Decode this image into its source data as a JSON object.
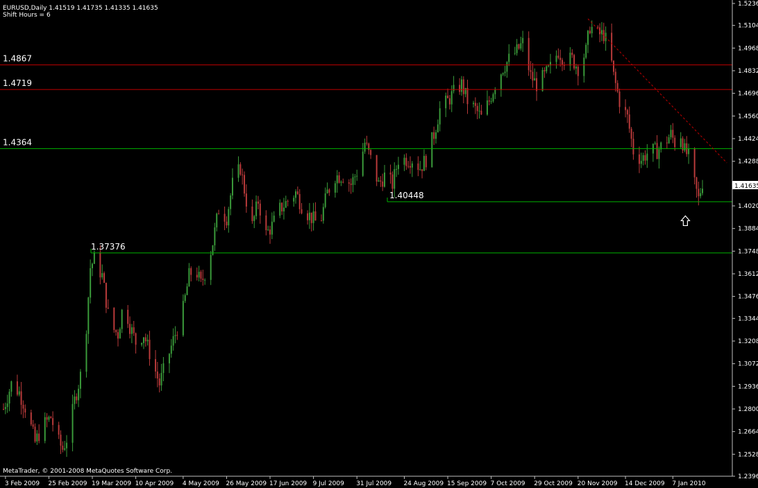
{
  "header": {
    "symbol_line": "EURUSD,Daily  1.41519 1.41735 1.41335 1.41635",
    "indicator_line": "Shift Hours = 6"
  },
  "footer": {
    "copyright": "MetaTrader, © 2001-2008 MetaQuotes Software Corp."
  },
  "current_price_label": "1.41635",
  "colors": {
    "background": "#000000",
    "bull": "#3a9a3a",
    "bear": "#b83a3a",
    "red_line": "#c00000",
    "green_line": "#00b400",
    "axis": "#c0c0c0",
    "arrow": "#ffffff"
  },
  "chart_data": {
    "type": "candlestick",
    "symbol": "EURUSD",
    "timeframe": "Daily",
    "ylim": [
      1.2396,
      1.5236
    ],
    "y_ticks": [
      "1.52360",
      "1.51040",
      "1.49680",
      "1.48320",
      "1.46960",
      "1.45600",
      "1.44240",
      "1.42880",
      "1.40200",
      "1.38840",
      "1.37480",
      "1.36120",
      "1.34760",
      "1.33440",
      "1.32080",
      "1.30720",
      "1.29360",
      "1.28000",
      "1.26640",
      "1.25280",
      "1.23960"
    ],
    "x_ticks": [
      "3 Feb 2009",
      "25 Feb 2009",
      "19 Mar 2009",
      "10 Apr 2009",
      "4 May 2009",
      "26 May 2009",
      "17 Jun 2009",
      "9 Jul 2009",
      "31 Jul 2009",
      "24 Aug 2009",
      "15 Sep 2009",
      "7 Oct 2009",
      "29 Oct 2009",
      "20 Nov 2009",
      "14 Dec 2009",
      "7 Jan 2010"
    ],
    "horizontal_levels": [
      {
        "label": "1.4867",
        "value": 1.4867,
        "color": "red"
      },
      {
        "label": "1.4719",
        "value": 1.4719,
        "color": "red"
      },
      {
        "label": "1.4364",
        "value": 1.4364,
        "color": "green"
      },
      {
        "label": "1.40448",
        "value": 1.40448,
        "color": "green"
      },
      {
        "label": "1.37376",
        "value": 1.37376,
        "color": "green"
      }
    ],
    "trendline": {
      "from": {
        "date": "2009-11-25",
        "value": 1.5144
      },
      "to": {
        "date": "2010-01-21",
        "value": 1.427
      },
      "style": "dashed",
      "color": "red"
    },
    "arrow": {
      "date": "2010-01-13",
      "value": 1.401,
      "direction": "up"
    },
    "close_path": [
      [
        "2009-02-02",
        1.28
      ],
      [
        "2009-02-06",
        1.295
      ],
      [
        "2009-02-10",
        1.29
      ],
      [
        "2009-02-14",
        1.278
      ],
      [
        "2009-02-18",
        1.26
      ],
      [
        "2009-02-22",
        1.27
      ],
      [
        "2009-02-26",
        1.275
      ],
      [
        "2009-03-02",
        1.26
      ],
      [
        "2009-03-04",
        1.256
      ],
      [
        "2009-03-07",
        1.265
      ],
      [
        "2009-03-10",
        1.285
      ],
      [
        "2009-03-13",
        1.3
      ],
      [
        "2009-03-16",
        1.33
      ],
      [
        "2009-03-18",
        1.365
      ],
      [
        "2009-03-20",
        1.37
      ],
      [
        "2009-03-24",
        1.36
      ],
      [
        "2009-03-28",
        1.33
      ],
      [
        "2009-04-01",
        1.325
      ],
      [
        "2009-04-04",
        1.345
      ],
      [
        "2009-04-07",
        1.33
      ],
      [
        "2009-04-10",
        1.32
      ],
      [
        "2009-04-14",
        1.325
      ],
      [
        "2009-04-18",
        1.31
      ],
      [
        "2009-04-22",
        1.295
      ],
      [
        "2009-04-26",
        1.31
      ],
      [
        "2009-04-30",
        1.325
      ],
      [
        "2009-05-04",
        1.34
      ],
      [
        "2009-05-07",
        1.36
      ],
      [
        "2009-05-10",
        1.365
      ],
      [
        "2009-05-13",
        1.355
      ],
      [
        "2009-05-16",
        1.365
      ],
      [
        "2009-05-19",
        1.38
      ],
      [
        "2009-05-22",
        1.4
      ],
      [
        "2009-05-26",
        1.395
      ],
      [
        "2009-05-29",
        1.415
      ],
      [
        "2009-06-02",
        1.425
      ],
      [
        "2009-06-05",
        1.405
      ],
      [
        "2009-06-08",
        1.39
      ],
      [
        "2009-06-11",
        1.405
      ],
      [
        "2009-06-15",
        1.385
      ],
      [
        "2009-06-18",
        1.39
      ],
      [
        "2009-06-22",
        1.4
      ],
      [
        "2009-06-26",
        1.405
      ],
      [
        "2009-06-30",
        1.41
      ],
      [
        "2009-07-04",
        1.4
      ],
      [
        "2009-07-08",
        1.395
      ],
      [
        "2009-07-12",
        1.39
      ],
      [
        "2009-07-16",
        1.41
      ],
      [
        "2009-07-20",
        1.42
      ],
      [
        "2009-07-24",
        1.42
      ],
      [
        "2009-07-28",
        1.415
      ],
      [
        "2009-08-01",
        1.425
      ],
      [
        "2009-08-04",
        1.44
      ],
      [
        "2009-08-07",
        1.43
      ],
      [
        "2009-08-11",
        1.415
      ],
      [
        "2009-08-14",
        1.42
      ],
      [
        "2009-08-18",
        1.415
      ],
      [
        "2009-08-21",
        1.43
      ],
      [
        "2009-08-25",
        1.43
      ],
      [
        "2009-08-28",
        1.43
      ],
      [
        "2009-09-01",
        1.425
      ],
      [
        "2009-09-04",
        1.43
      ],
      [
        "2009-09-08",
        1.445
      ],
      [
        "2009-09-11",
        1.46
      ],
      [
        "2009-09-15",
        1.465
      ],
      [
        "2009-09-18",
        1.47
      ],
      [
        "2009-09-22",
        1.475
      ],
      [
        "2009-09-25",
        1.465
      ],
      [
        "2009-09-29",
        1.46
      ],
      [
        "2009-10-02",
        1.455
      ],
      [
        "2009-10-06",
        1.465
      ],
      [
        "2009-10-09",
        1.475
      ],
      [
        "2009-10-13",
        1.485
      ],
      [
        "2009-10-16",
        1.49
      ],
      [
        "2009-10-20",
        1.495
      ],
      [
        "2009-10-23",
        1.5
      ],
      [
        "2009-10-27",
        1.48
      ],
      [
        "2009-10-30",
        1.475
      ],
      [
        "2009-11-03",
        1.48
      ],
      [
        "2009-11-06",
        1.485
      ],
      [
        "2009-11-10",
        1.495
      ],
      [
        "2009-11-13",
        1.49
      ],
      [
        "2009-11-17",
        1.49
      ],
      [
        "2009-11-20",
        1.485
      ],
      [
        "2009-11-24",
        1.495
      ],
      [
        "2009-11-26",
        1.51
      ],
      [
        "2009-11-30",
        1.505
      ],
      [
        "2009-12-03",
        1.505
      ],
      [
        "2009-12-06",
        1.495
      ],
      [
        "2009-12-08",
        1.48
      ],
      [
        "2009-12-11",
        1.465
      ],
      [
        "2009-12-15",
        1.455
      ],
      [
        "2009-12-18",
        1.435
      ],
      [
        "2009-12-22",
        1.43
      ],
      [
        "2009-12-26",
        1.435
      ],
      [
        "2009-12-30",
        1.435
      ],
      [
        "2010-01-03",
        1.44
      ],
      [
        "2010-01-06",
        1.445
      ],
      [
        "2010-01-08",
        1.44
      ],
      [
        "2010-01-11",
        1.445
      ],
      [
        "2010-01-13",
        1.435
      ],
      [
        "2010-01-16",
        1.43
      ],
      [
        "2010-01-18",
        1.415
      ],
      [
        "2010-01-20",
        1.406
      ],
      [
        "2010-01-22",
        1.4163
      ]
    ]
  }
}
